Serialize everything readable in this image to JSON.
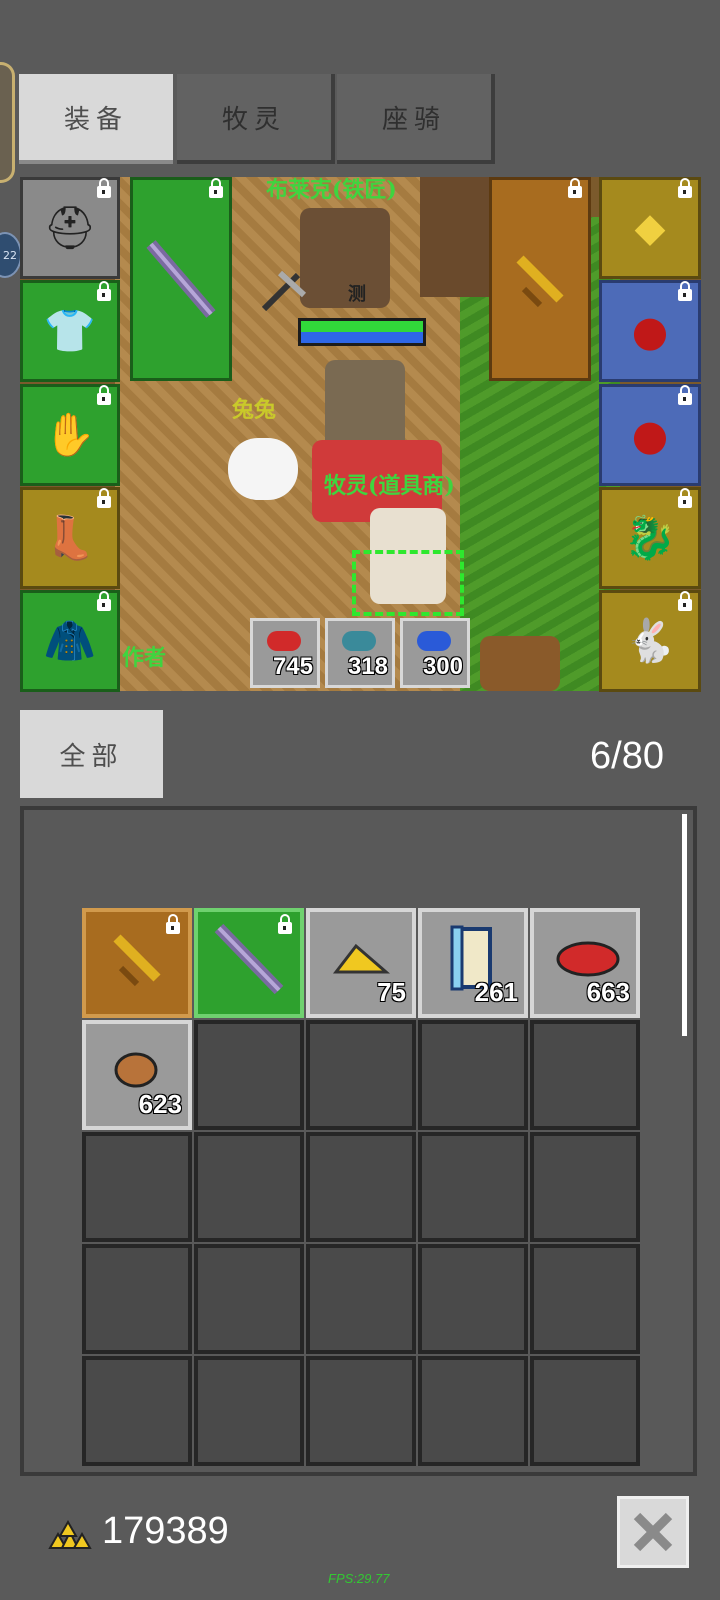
{
  "side_badge": "22",
  "tabs": [
    {
      "label": "装备",
      "active": true
    },
    {
      "label": "牧灵",
      "active": false
    },
    {
      "label": "座骑",
      "active": false
    }
  ],
  "scene": {
    "npc_blacksmith_name": "布莱克(铁匠)",
    "pet_name": "兔兔",
    "npc_shop_name": "牧灵(道具商)",
    "author_label": "作者",
    "tags": [
      "测"
    ],
    "consumables": [
      {
        "icon": "red-potion-icon",
        "qty": "745"
      },
      {
        "icon": "teal-potion-icon",
        "qty": "318"
      },
      {
        "icon": "blue-potion-icon",
        "qty": "300"
      }
    ]
  },
  "equipment": {
    "left_slots": [
      "helmet-icon",
      "chest-armor-icon",
      "gloves-icon",
      "boots-icon",
      "cloak-icon"
    ],
    "weapon_slot": "purple-sword-icon",
    "offhand_slot": "gold-sword-icon",
    "right_slots": [
      "necklace-icon",
      "ruby-ring-icon",
      "ruby-ring-icon",
      "dragon-mount-icon",
      "rabbit-pet-icon"
    ]
  },
  "inventory": {
    "filter_label": "全部",
    "count": "6/80",
    "items": [
      {
        "icon": "gold-sword-icon",
        "qty": "",
        "locked": true,
        "style": "brown"
      },
      {
        "icon": "purple-sword-icon",
        "qty": "",
        "locked": true,
        "style": "green"
      },
      {
        "icon": "gold-nugget-icon",
        "qty": "75",
        "locked": false,
        "style": "gray"
      },
      {
        "icon": "scroll-icon",
        "qty": "261",
        "locked": false,
        "style": "gray"
      },
      {
        "icon": "red-feather-icon",
        "qty": "663",
        "locked": false,
        "style": "gray"
      },
      {
        "icon": "meat-icon",
        "qty": "623",
        "locked": false,
        "style": "gray"
      }
    ],
    "visible_slots": 25
  },
  "footer": {
    "gold": "179389",
    "fps": "FPS:29.77"
  },
  "colors": {
    "background": "#5a5a5a",
    "tab_active": "#d9d9d9",
    "tab_inactive": "#626262",
    "hp": "#31d83a",
    "mp": "#2e67e8",
    "fps": "#32c832"
  }
}
